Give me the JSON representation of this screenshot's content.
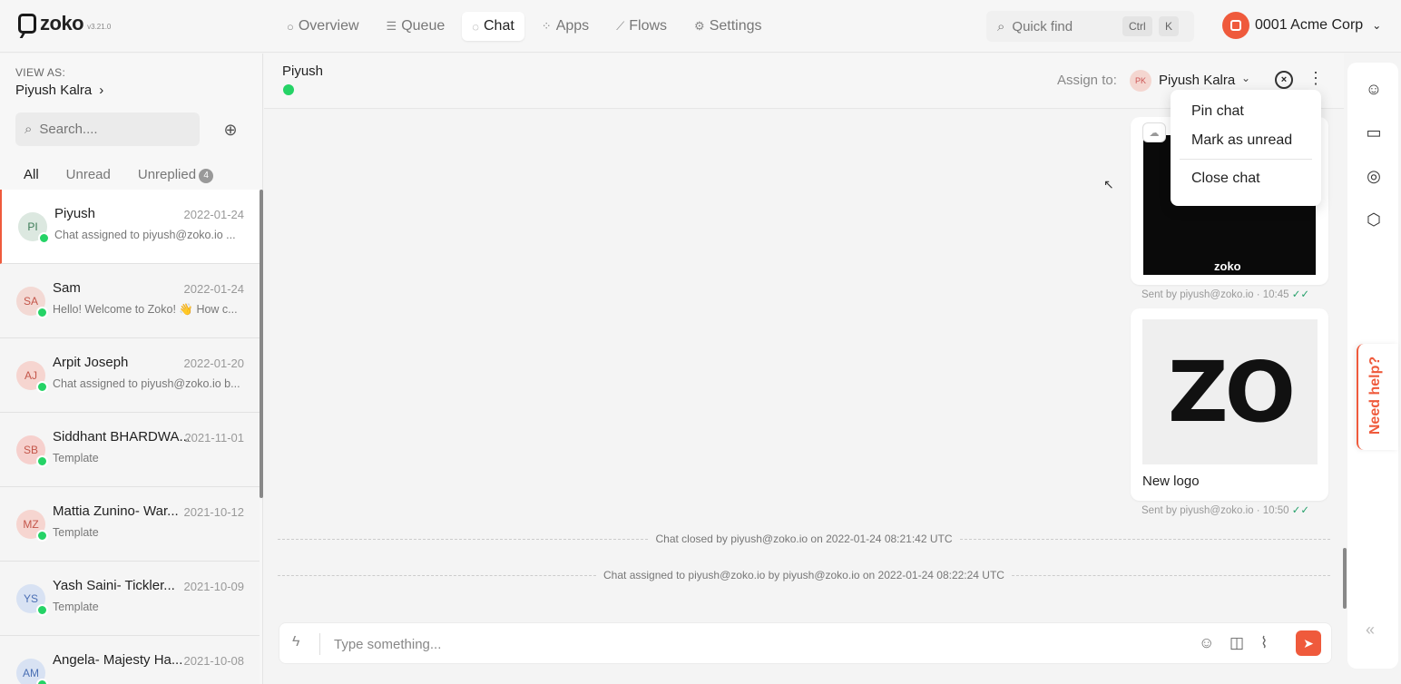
{
  "brand": {
    "name": "zoko",
    "version": "v3.21.0"
  },
  "nav": [
    {
      "label": "Overview",
      "icon": "○"
    },
    {
      "label": "Queue",
      "icon": "☰"
    },
    {
      "label": "Chat",
      "icon": "◌",
      "active": true
    },
    {
      "label": "Apps",
      "icon": "⁘"
    },
    {
      "label": "Flows",
      "icon": "⟋"
    },
    {
      "label": "Settings",
      "icon": "⚙"
    }
  ],
  "quickfind": {
    "label": "Quick find",
    "key1": "Ctrl",
    "key2": "K"
  },
  "org": {
    "name": "0001 Acme Corp"
  },
  "sidebar": {
    "view_as_label": "VIEW AS:",
    "view_as_name": "Piyush Kalra",
    "search_placeholder": "Search....",
    "tabs": {
      "all": "All",
      "unread": "Unread",
      "unreplied": "Unreplied",
      "unreplied_count": "4"
    },
    "chats": [
      {
        "initials": "PI",
        "name": "Piyush",
        "date": "2022-01-24",
        "preview": "Chat assigned to piyush@zoko.io ...",
        "bg": "#dce8e0",
        "fg": "#3a7a55"
      },
      {
        "initials": "SA",
        "name": "Sam",
        "date": "2022-01-24",
        "preview": "Hello! Welcome to Zoko! 👋 How c...",
        "bg": "#f3d9d4",
        "fg": "#c4564a"
      },
      {
        "initials": "AJ",
        "name": "Arpit Joseph",
        "date": "2022-01-20",
        "preview": "Chat assigned to piyush@zoko.io b...",
        "bg": "#f6d5d0",
        "fg": "#c4564a"
      },
      {
        "initials": "SB",
        "name": "Siddhant BHARDWA...",
        "date": "2021-11-01",
        "preview": "Template",
        "bg": "#f6d0cd",
        "fg": "#c4564a"
      },
      {
        "initials": "MZ",
        "name": "Mattia Zunino- War...",
        "date": "2021-10-12",
        "preview": "Template",
        "bg": "#f6d5d0",
        "fg": "#c4564a"
      },
      {
        "initials": "YS",
        "name": "Yash Saini- Tickler...",
        "date": "2021-10-09",
        "preview": "Template",
        "bg": "#d8e2f3",
        "fg": "#4a6fb4"
      },
      {
        "initials": "AM",
        "name": "Angela- Majesty Ha...",
        "date": "2021-10-08",
        "preview": "",
        "bg": "#d8e2f3",
        "fg": "#4a6fb4"
      }
    ]
  },
  "chat": {
    "contact_name": "Piyush",
    "assign_label": "Assign to:",
    "assignee_initials": "PK",
    "assignee_name": "Piyush Kalra",
    "messages": [
      {
        "type": "image",
        "meta": "Sent by piyush@zoko.io · 10:45",
        "image_text": "zoko"
      },
      {
        "type": "image",
        "meta": "Sent by piyush@zoko.io · 10:50",
        "image_text": "ZO",
        "caption": "New logo"
      }
    ],
    "system": [
      "Chat closed by piyush@zoko.io on 2022-01-24 08:21:42 UTC",
      "Chat assigned to piyush@zoko.io by piyush@zoko.io on 2022-01-24 08:22:24 UTC"
    ],
    "composer_placeholder": "Type something..."
  },
  "menu": {
    "pin": "Pin chat",
    "unread": "Mark as unread",
    "close": "Close chat"
  },
  "help": {
    "label": "Need help?"
  },
  "colors": {
    "accent": "#ef5a3c",
    "whatsapp": "#25d366"
  }
}
